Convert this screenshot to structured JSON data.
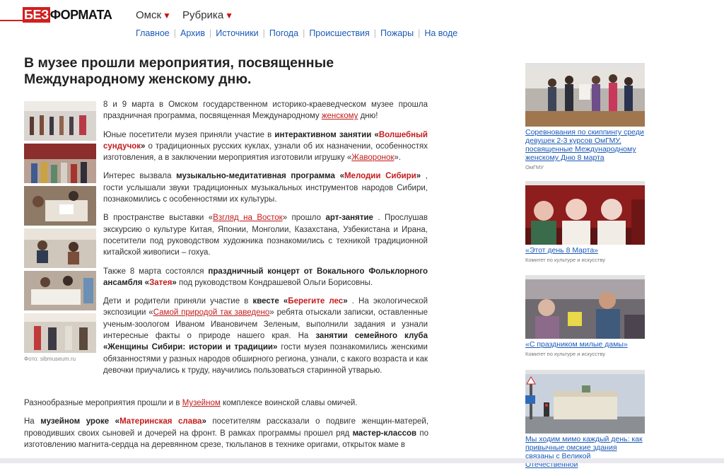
{
  "logo": {
    "part1": "БЕЗ",
    "part2": "ФОРМАТА"
  },
  "topnav": [
    {
      "label": "Омск",
      "arrow": "▼"
    },
    {
      "label": "Рубрика",
      "arrow": "▼"
    }
  ],
  "subnav": [
    "Главное",
    "Архив",
    "Источники",
    "Погода",
    "Происшествия",
    "Пожары",
    "На воде"
  ],
  "article": {
    "title": "В музее прошли мероприятия, посвященные Международному женскому дню.",
    "photo_caption": "Фото: sibmuseum.ru",
    "p1": {
      "a": "8 и 9 марта в Омском государственном историко-краеведческом музее прошла праздничная программа, посвященная Международному ",
      "link": "женскому",
      "b": " дню!"
    },
    "p2": {
      "a": "Юные посетители музея приняли участие в ",
      "bold1": "интерактивном занятии «",
      "red1": "Волшебный сундучок",
      "bold1end": "»",
      "b": " о традиционных русских куклах, узнали об их назначении, особенностях изготовления, а в заключении мероприятия изготовили игрушку «",
      "link": "Жаворонок",
      "c": "»."
    },
    "p3": {
      "a": "Интерес вызвала ",
      "bold1": "музыкально-медитативная программа «",
      "red1": "Мелодии Сибири",
      "bold1end": "»",
      "b": " , гости услышали звуки традиционных музыкальных инструментов народов Сибири, познакомились с особенностями их культуры."
    },
    "p4": {
      "a": "В пространстве выставки «",
      "link": "Взгляд на Восток",
      "b": "» прошло ",
      "bold1": "арт-занятие",
      "c": " . Прослушав экскурсию о культуре Китая, Японии, Монголии, Казахстана, Узбекистана и Ирана, посетители под руководством художника познакомились с техникой традиционной китайской живописи – гохуа."
    },
    "p5": {
      "a": "Также 8 марта состоялся ",
      "bold1": "праздничный концерт от Вокального Фольклорного ансамбля «",
      "red1": "Затея",
      "bold1end": "»",
      "b": " под руководством Кондрашевой Ольги Борисовны."
    },
    "p6": {
      "a": "Дети и родители приняли участие в ",
      "bold1": "квесте «",
      "red1": "Берегите лес",
      "bold1end": "»",
      "b": " . На экологической экспозиции «",
      "link": "Самой природой так заведено",
      "c": "» ребята отыскали записки, оставленные ученым-зоологом Иваном Ивановичем Зеленым, выполнили задания и узнали интересные факты о природе нашего края. На ",
      "bold2": "занятии семейного клуба «Женщины Сибири: истории и традиции»",
      "d": " гости музея познакомились женскими обязанностями у разных народов обширного региона, узнали, с какого возраста и как девочки приучались к труду, научились пользоваться старинной утварью."
    },
    "p7": {
      "a": "Разнообразные мероприятия прошли и в ",
      "link": "Музейном",
      "b": " комплексе воинской славы омичей."
    },
    "p8": {
      "a": "На ",
      "bold1": "музейном уроке «",
      "red1": "Материнская слава",
      "bold1end": "»",
      "b": " посетителям рассказали о подвиге женщин-матерей, проводивших своих сыновей и дочерей на фронт. В рамках программы прошел ряд ",
      "bold2": "мастер-классов",
      "c": " по изготовлению магнита-сердца на деревянном срезе, тюльпанов в технике оригами, открыток маме в"
    }
  },
  "sidebar": [
    {
      "headline": "Соревнования по скиппингу среди девушек 2-3 курсов ОмГМУ, посвященные Международному женскому Дню 8 марта",
      "source": "ОмГМУ"
    },
    {
      "headline": "«Этот день 8 Марта»",
      "source": "Комитет по культуре и искусству"
    },
    {
      "headline": "«С праздником милые дамы»",
      "source": "Комитет по культуре и искусству"
    },
    {
      "headline": "Мы ходим мимо каждый день: как привычные омские здания связаны с Великой Отечественной",
      "source": ""
    }
  ],
  "colors": {
    "brand_red": "#d21f1f",
    "link_blue": "#1a5ab8",
    "accent_red": "#c41b1b"
  }
}
